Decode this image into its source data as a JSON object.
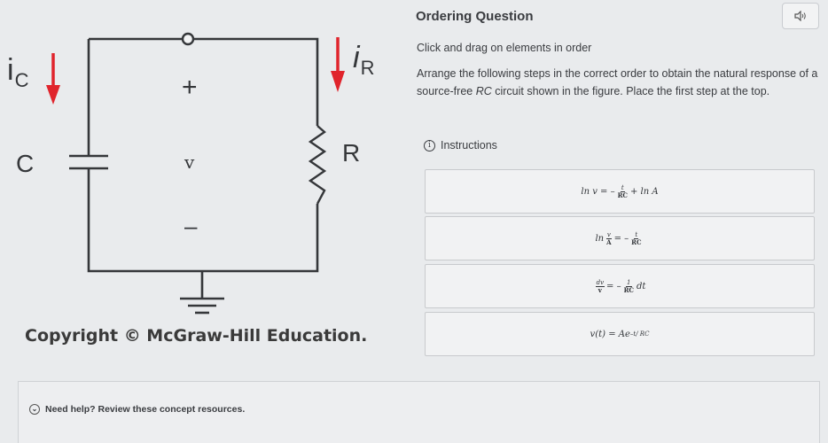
{
  "figure": {
    "label_ic": "i",
    "label_ic_sub": "C",
    "label_ir": "i",
    "label_ir_sub": "R",
    "label_c": "C",
    "label_r": "R",
    "label_v": "v",
    "label_plus": "+",
    "label_minus": "–",
    "copyright": "Copyright © McGraw-Hill Education.",
    "arrow_color": "#e0242c"
  },
  "question": {
    "title": "Ordering Question",
    "instruction_line": "Click and drag on elements in order",
    "prompt_before": "Arrange the following steps in the correct order to obtain the natural response of a source-free ",
    "prompt_rc": "RC",
    "prompt_after": " circuit shown in the figure. Place the first step at the top.",
    "instructions_label": "Instructions",
    "audio_icon": "speaker-icon"
  },
  "steps": [
    {
      "a": "ln v = –",
      "f_num": "t",
      "f_den": "RC",
      "b": " + ln A"
    },
    {
      "a": "ln ",
      "f_num": "v",
      "f_den": "A",
      "b": " = – ",
      "g_num": "t",
      "g_den": "RC"
    },
    {
      "f_num": "dv",
      "f_den": "v",
      "b": " = – ",
      "g_num": "1",
      "g_den": "RC",
      "c": " dt"
    },
    {
      "a": "v(t) = Ae",
      "sup": "–t/ RC"
    }
  ],
  "help": {
    "label": "Need help? Review these concept resources."
  }
}
